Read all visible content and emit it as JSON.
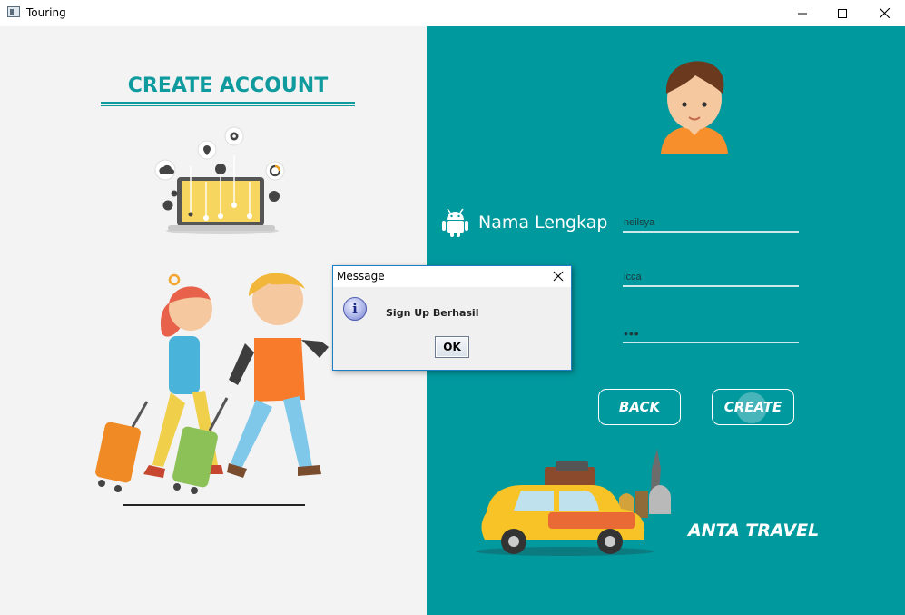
{
  "window": {
    "title": "Touring"
  },
  "left": {
    "heading": "CREATE ACCOUNT"
  },
  "form": {
    "name_label": "Nama Lengkap",
    "field1_value": "neilsya",
    "field2_value": "icca",
    "field3_value": "•••"
  },
  "buttons": {
    "back": "BACK",
    "create": "CREATE"
  },
  "brand": "ANTA TRAVEL",
  "dialog": {
    "title": "Message",
    "message": "Sign Up Berhasil",
    "ok": "OK"
  },
  "colors": {
    "teal": "#00999e",
    "heading": "#0f9a9e",
    "left_bg": "#f3f3f3"
  }
}
